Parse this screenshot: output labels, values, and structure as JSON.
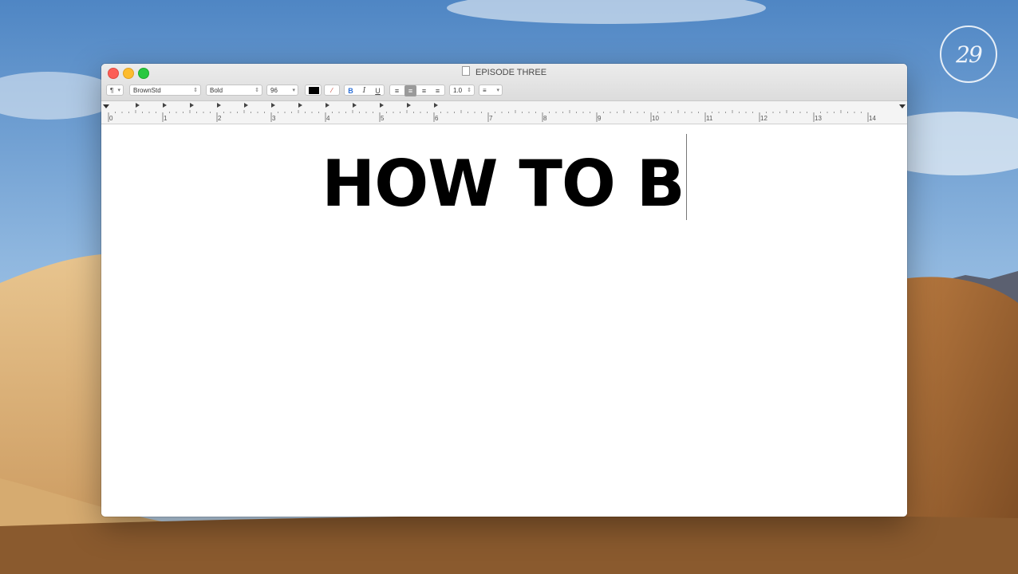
{
  "watermark": {
    "text": "29"
  },
  "window": {
    "title": "EPISODE THREE",
    "toolbar": {
      "paragraph_style": "¶",
      "font_family": "BrownStd",
      "font_style": "Bold",
      "font_size": "96",
      "bold_label": "B",
      "italic_label": "I",
      "underline_label": "U",
      "line_spacing": "1.0",
      "list_label": "≡",
      "text_color": "#000000"
    },
    "ruler": {
      "labels": [
        "0",
        "1",
        "2",
        "3",
        "4",
        "5",
        "6",
        "7",
        "8",
        "9",
        "10",
        "11",
        "12",
        "13",
        "14"
      ]
    },
    "document": {
      "text": "HOW TO B"
    }
  }
}
